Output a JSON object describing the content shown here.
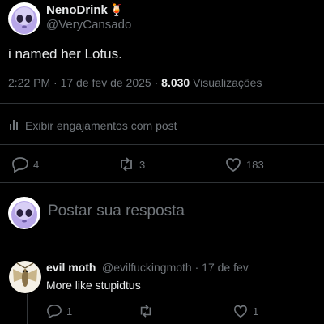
{
  "post": {
    "author_name": "NenoDrink",
    "author_emoji": "🍹",
    "author_handle": "@VeryCansado",
    "text": "i named her Lotus.",
    "time": "2:22 PM",
    "date": "17 de fev de 2025",
    "views_count": "8.030",
    "views_label": "Visualizações",
    "engagements_label": "Exibir engajamentos com post",
    "replies": "4",
    "reposts": "3",
    "likes": "183"
  },
  "composer": {
    "placeholder": "Postar sua resposta"
  },
  "reply": {
    "author_name": "evil moth",
    "author_handle": "@evilfuckingmoth",
    "date": "17 de fev",
    "text": "More like stupidtus",
    "replies": "1",
    "likes": "1"
  },
  "colors": {
    "background": "#000000",
    "text": "#e7e9ea",
    "muted": "#71767b",
    "divider": "#2f3336",
    "avatar_purple": "#b7a6e8"
  }
}
